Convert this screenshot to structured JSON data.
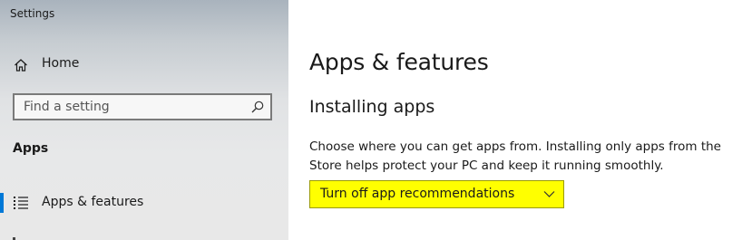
{
  "window": {
    "title": "Settings"
  },
  "sidebar": {
    "home_label": "Home",
    "search": {
      "placeholder": "Find a setting",
      "value": ""
    },
    "section_label": "Apps",
    "items": [
      {
        "label": "Apps & features",
        "icon": "apps-features-icon",
        "selected": true
      }
    ]
  },
  "main": {
    "page_title": "Apps & features",
    "section_heading": "Installing apps",
    "description": "Choose where you can get apps from. Installing only apps from the Store helps protect your PC and keep it running smoothly.",
    "dropdown": {
      "selected": "Turn off app recommendations"
    }
  },
  "colors": {
    "accent": "#0078d7",
    "dropdown_highlight": "#ffff00"
  }
}
